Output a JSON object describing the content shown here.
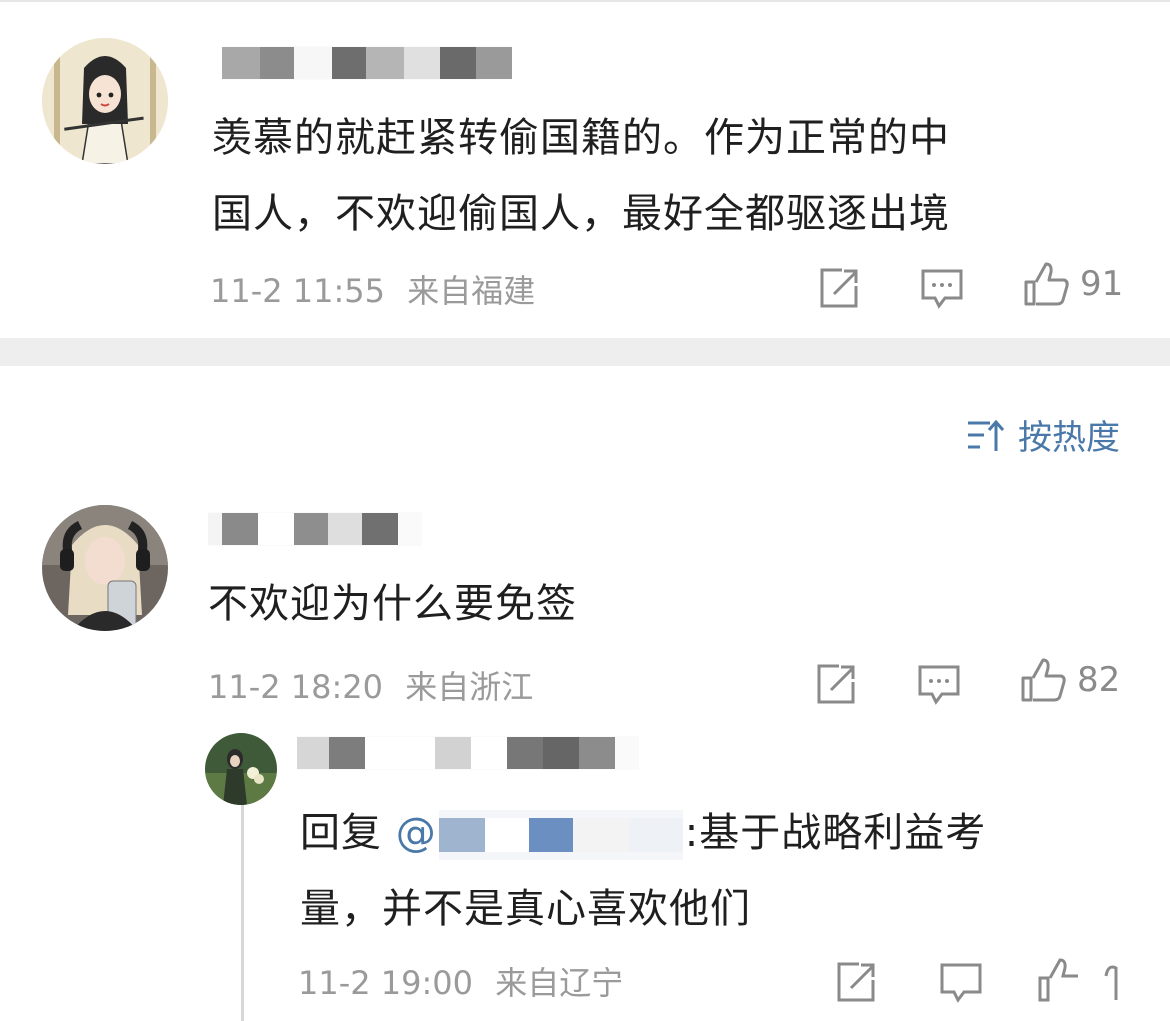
{
  "comments": [
    {
      "text_line1": "羡慕的就赶紧转偷国籍的。作为正常的中",
      "text_line2": "国人，不欢迎偷国人，最好全都驱逐出境",
      "time": "11-2 11:55",
      "location": "来自福建",
      "likes": "91"
    },
    {
      "text": "不欢迎为什么要免签",
      "time": "11-2 18:20",
      "location": "来自浙江",
      "likes": "82"
    }
  ],
  "sort": {
    "label": "按热度"
  },
  "reply": {
    "prefix": "回复",
    "mention": "@",
    "text_line1": ":基于战略利益考",
    "text_line2": "量，并不是真心喜欢他们",
    "time": "11-2 19:00",
    "location": "来自辽宁"
  },
  "colors": {
    "accent": "#4a78a8",
    "meta": "#9a9a9a",
    "band": "#eeeeee"
  },
  "icons": [
    "share-icon",
    "comment-icon",
    "like-icon",
    "sort-icon"
  ]
}
